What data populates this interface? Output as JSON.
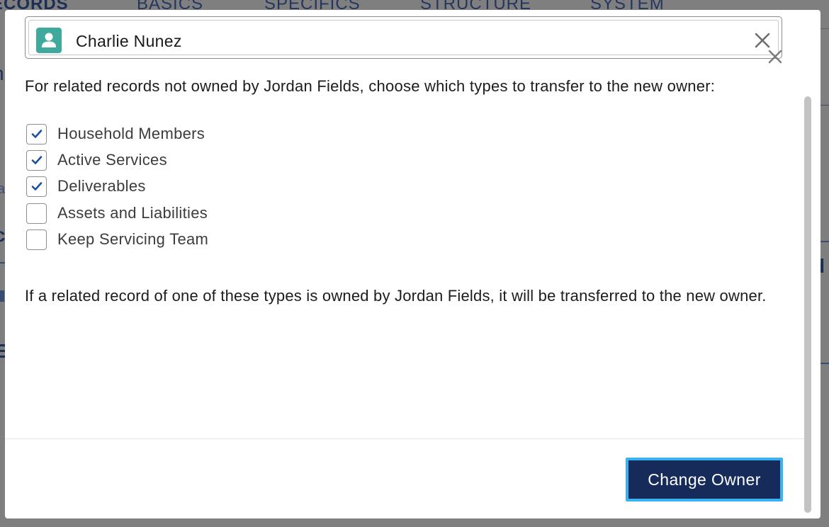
{
  "background": {
    "tabs": [
      "ECORDS",
      "BASICS",
      "SPECIFICS",
      "STRUCTURE",
      "SYSTEM"
    ],
    "frag_a": "a",
    "frag_h": "h",
    "frag_c": "c",
    "frag_d": "d",
    "frag_e": "E"
  },
  "lookup": {
    "selected_value": "Charlie Nunez",
    "icon": "user-avatar-icon",
    "accent_color": "#3fa99e"
  },
  "prompt_text": "For related records not owned by Jordan Fields, choose which types to transfer to the new owner:",
  "transfer_types": [
    {
      "label": "Household Members",
      "checked": true
    },
    {
      "label": "Active Services",
      "checked": true
    },
    {
      "label": "Deliverables",
      "checked": true
    },
    {
      "label": "Assets and Liabilities",
      "checked": false
    },
    {
      "label": "Keep Servicing Team",
      "checked": false
    }
  ],
  "note_text": "If a related record of one of these types is owned by Jordan Fields, it will be transferred to the new owner.",
  "footer": {
    "primary_button_label": "Change Owner",
    "primary_color": "#172b5a",
    "focus_ring_color": "#3ab2f2"
  }
}
